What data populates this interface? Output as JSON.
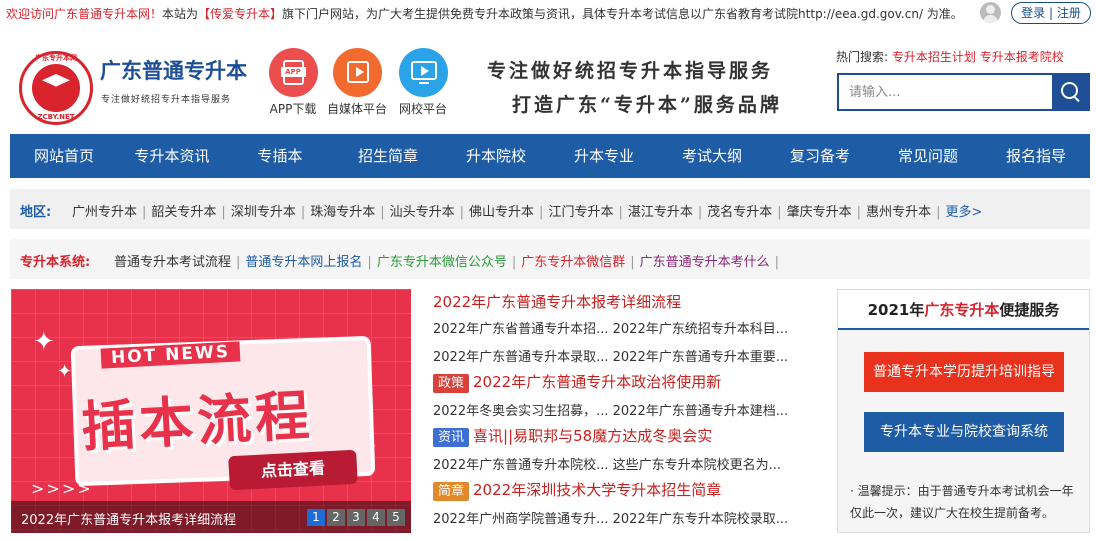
{
  "topbar": {
    "welcome": "欢迎访问广东普通专升本网！",
    "notice_pre": "本站为",
    "brand_bracket": "【传爱专升本】",
    "notice_post": "旗下门户网站，为广大考生提供免费专升本政策与资讯，具体专升本考试信息以广东省教育考试院http://eea.gd.gov.cn/ 为准。",
    "login": "登录",
    "register": "注册",
    "login_sep": " | "
  },
  "header": {
    "logo_title": "广东普通专升本",
    "logo_subtitle": "专注做好统招专升本指导服务",
    "logo_arc": "广东专升本网",
    "logo_net": "ZCBY.NET",
    "apps": [
      {
        "label": "APP下载",
        "icon": "app-download-icon",
        "icon_text": "APP"
      },
      {
        "label": "自媒体平台",
        "icon": "media-play-icon"
      },
      {
        "label": "网校平台",
        "icon": "video-screen-icon"
      }
    ],
    "slogan1": "专注做好统招专升本指导服务",
    "slogan2": "打造广东“专升本”服务品牌",
    "hot_label": "热门搜索:",
    "hot_links": [
      "专升本招生计划",
      "专升本报考院校"
    ],
    "search_placeholder": "请输入..."
  },
  "nav": [
    "网站首页",
    "专升本资讯",
    "专插本",
    "招生简章",
    "升本院校",
    "升本专业",
    "考试大纲",
    "复习备考",
    "常见问题",
    "报名指导"
  ],
  "region": {
    "title": "地区:",
    "items": [
      "广州专升本",
      "韶关专升本",
      "深圳专升本",
      "珠海专升本",
      "汕头专升本",
      "佛山专升本",
      "江门专升本",
      "湛江专升本",
      "茂名专升本",
      "肇庆专升本",
      "惠州专升本"
    ],
    "more": "更多>"
  },
  "system": {
    "title": "专升本系统:",
    "items": [
      {
        "text": "普通专升本考试流程",
        "color": "dark"
      },
      {
        "text": "普通专升本网上报名",
        "color": "blue"
      },
      {
        "text": "广东专升本微信公众号",
        "color": "green"
      },
      {
        "text": "广东专升本微信群",
        "color": "red"
      },
      {
        "text": "广东普通专升本考什么",
        "color": "purple"
      }
    ]
  },
  "banner": {
    "hot_news": "HOT NEWS",
    "big_text": "插本流程",
    "click_text": "点击查看",
    "caption": "2022年广东普通专升本报考详细流程",
    "pages": [
      "1",
      "2",
      "3",
      "4",
      "5"
    ],
    "active_page": "1"
  },
  "news": [
    {
      "type": "headline",
      "text": "2022年广东普通专升本报考详细流程"
    },
    {
      "type": "pair",
      "a": "2022年广东省普通专升本招...",
      "b": "2022年广东统招专升本科目..."
    },
    {
      "type": "pair",
      "a": "2022年广东普通专升本录取...",
      "b": "2022年广东普通专升本重要..."
    },
    {
      "type": "tagged",
      "tag": "政策",
      "tag_color": "red",
      "text": "2022年广东普通专升本政治将使用新"
    },
    {
      "type": "pair",
      "a": "2022年冬奥会实习生招募，...",
      "b": "2022年广东普通专升本建档..."
    },
    {
      "type": "tagged",
      "tag": "资讯",
      "tag_color": "blue",
      "text": "喜讯||易职邦与58魔方达成冬奥会实"
    },
    {
      "type": "pair",
      "a": "2022年广东普通专升本院校...",
      "b": "这些广东专升本院校更名为..."
    },
    {
      "type": "tagged",
      "tag": "简章",
      "tag_color": "orange",
      "text": "2022年深圳技术大学专升本招生简章"
    },
    {
      "type": "pair",
      "a": "2022年广州商学院普通专升...",
      "b": "2022年广东专升本院校录取..."
    }
  ],
  "service": {
    "title_pre": "2021年",
    "title_red": "广东专升本",
    "title_post": "便捷服务",
    "btn1": "普通专升本学历提升培训指导",
    "btn2": "专升本专业与院校查询系统",
    "tip": "· 温馨提示：由于普通专升本考试机会一年仅此一次，建议广大在校生提前备考。"
  },
  "colors": {
    "brand_blue": "#1e5ca6",
    "brand_red": "#d9232d",
    "banner_red": "#e8314a"
  }
}
